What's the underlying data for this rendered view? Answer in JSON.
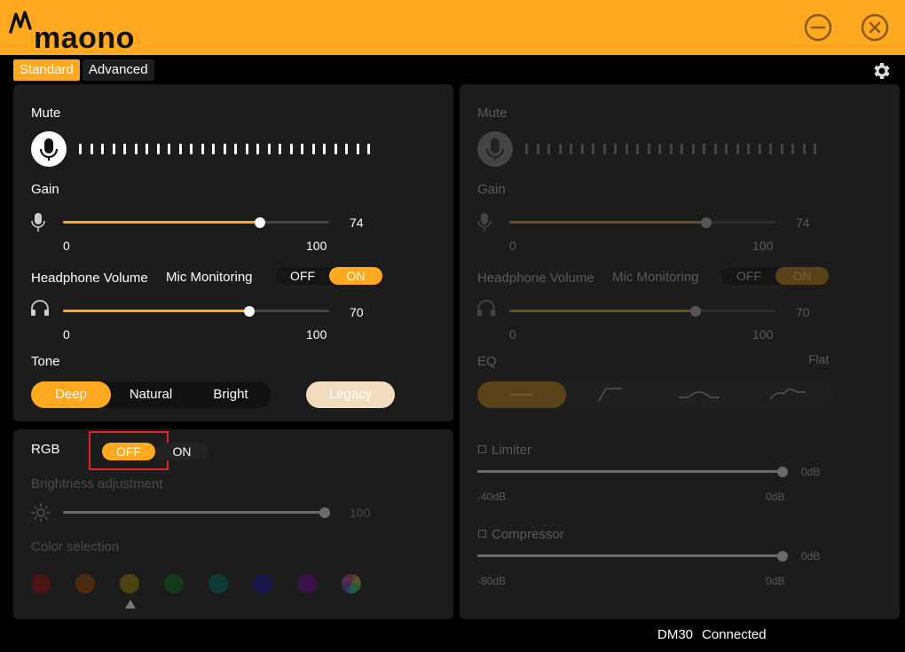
{
  "app": {
    "brand": "maono",
    "colors": {
      "accent": "#ffa920",
      "background": "#000000",
      "panel": "#1c1c1c",
      "highlight_box": "#e0252a"
    }
  },
  "tabs": [
    {
      "label": "Standard",
      "active": true
    },
    {
      "label": "Advanced",
      "active": false
    }
  ],
  "left": {
    "mute_label": "Mute",
    "gain_label": "Gain",
    "gain": {
      "value": "74",
      "min": "0",
      "max": "100",
      "fraction": 0.74
    },
    "headphone_label": "Headphone Volume",
    "mic_monitoring_label": "Mic Monitoring",
    "mic_monitoring": {
      "off": "OFF",
      "on": "ON",
      "selected": "ON"
    },
    "headphone": {
      "value": "70",
      "min": "0",
      "max": "100",
      "fraction": 0.7
    },
    "tone_label": "Tone",
    "tone_options": [
      "Deep",
      "Natural",
      "Bright"
    ],
    "tone_selected": "Deep",
    "legacy_label": "Legacy"
  },
  "rgb": {
    "label": "RGB",
    "off": "OFF",
    "on": "ON",
    "selected": "OFF",
    "brightness_label": "Brightness adjustment",
    "brightness": {
      "value": "100",
      "fraction": 1.0
    },
    "color_label": "Color selection",
    "colors": [
      "#4a1414",
      "#4a2a10",
      "#4a4410",
      "#123a1a",
      "#0f3a3a",
      "#16164a",
      "#3a1448",
      "rainbow"
    ],
    "selected_color_index": 2
  },
  "right": {
    "mute_label": "Mute",
    "gain_label": "Gain",
    "gain": {
      "value": "74",
      "min": "0",
      "max": "100",
      "fraction": 0.74
    },
    "headphone_label": "Headphone Volume",
    "mic_monitoring_label": "Mic Monitoring",
    "mic_monitoring": {
      "off": "OFF",
      "on": "ON",
      "selected": "ON"
    },
    "headphone": {
      "value": "70",
      "min": "0",
      "max": "100",
      "fraction": 0.7
    },
    "eq_label": "EQ",
    "eq_preset": "Flat",
    "eq_icons": [
      "flat-eq-icon",
      "high-pass-eq-icon",
      "mid-boost-eq-icon",
      "presence-eq-icon"
    ],
    "eq_selected_index": 0,
    "limiter_label": "Limiter",
    "limiter": {
      "value": "0dB",
      "min": "-40dB",
      "max": "0dB",
      "fraction": 1.0
    },
    "compressor_label": "Compressor",
    "compressor": {
      "value": "0dB",
      "min": "-80dB",
      "max": "0dB",
      "fraction": 1.0
    }
  },
  "status": {
    "device": "DM30",
    "state": "Connected"
  }
}
